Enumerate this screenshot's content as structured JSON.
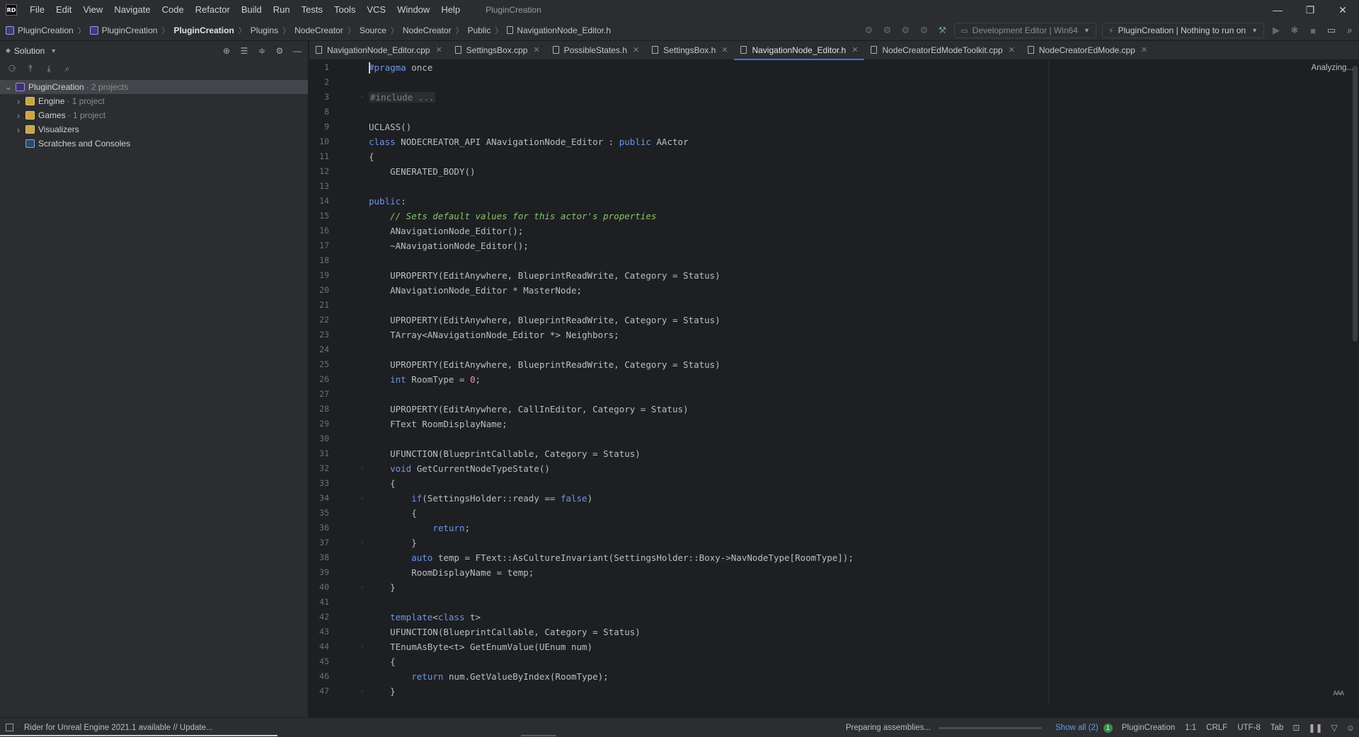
{
  "app": {
    "logo_text": "RD",
    "window_title": "PluginCreation"
  },
  "menu": [
    "File",
    "Edit",
    "View",
    "Navigate",
    "Code",
    "Refactor",
    "Build",
    "Run",
    "Tests",
    "Tools",
    "VCS",
    "Window",
    "Help"
  ],
  "window_controls": {
    "minimize": "—",
    "restore": "❐",
    "close": "✕"
  },
  "breadcrumb": [
    "PluginCreation",
    "PluginCreation",
    "PluginCreation",
    "Plugins",
    "NodeCreator",
    "Source",
    "NodeCreator",
    "Public",
    "NavigationNode_Editor.h"
  ],
  "toolbar": {
    "config_dropdown": "Development Editor | Win64",
    "run_dropdown": "PluginCreation | Nothing to run on",
    "icons": [
      "build-gear-icon",
      "build-solution-icon",
      "rebuild-icon",
      "clean-icon",
      "hammer-icon"
    ]
  },
  "solution": {
    "title": "Solution",
    "tree": [
      {
        "label": "PluginCreation",
        "meta": "· 2 projects",
        "icon": "solution-icon",
        "expanded": true,
        "selected": true
      },
      {
        "label": "Engine",
        "meta": "· 1 project",
        "icon": "folder-icon",
        "expanded": false
      },
      {
        "label": "Games",
        "meta": "· 1 project",
        "icon": "folder-icon",
        "expanded": false
      },
      {
        "label": "Visualizers",
        "meta": "",
        "icon": "folder-icon",
        "expanded": false
      },
      {
        "label": "Scratches and Consoles",
        "meta": "",
        "icon": "scratch-icon",
        "expanded": false
      }
    ]
  },
  "tabs": [
    {
      "label": "NavigationNode_Editor.cpp",
      "active": false
    },
    {
      "label": "SettingsBox.cpp",
      "active": false
    },
    {
      "label": "PossibleStates.h",
      "active": false
    },
    {
      "label": "SettingsBox.h",
      "active": false
    },
    {
      "label": "NavigationNode_Editor.h",
      "active": true
    },
    {
      "label": "NodeCreatorEdModeToolkit.cpp",
      "active": false
    },
    {
      "label": "NodeCreatorEdMode.cpp",
      "active": false
    }
  ],
  "editor": {
    "analyzing": "Analyzing...",
    "line_numbers": [
      "1",
      "2",
      "3",
      "8",
      "9",
      "10",
      "11",
      "12",
      "13",
      "14",
      "15",
      "16",
      "17",
      "18",
      "19",
      "20",
      "21",
      "22",
      "23",
      "24",
      "25",
      "26",
      "27",
      "28",
      "29",
      "30",
      "31",
      "32",
      "33",
      "34",
      "35",
      "36",
      "37",
      "38",
      "39",
      "40",
      "41",
      "42",
      "43",
      "44",
      "45",
      "46",
      "47"
    ],
    "lines": [
      "#pragma once",
      "",
      "#include ...",
      "",
      "UCLASS()",
      "class NODECREATOR_API ANavigationNode_Editor : public AActor",
      "{",
      "    GENERATED_BODY()",
      "",
      "public:",
      "    // Sets default values for this actor's properties",
      "    ANavigationNode_Editor();",
      "    ~ANavigationNode_Editor();",
      "",
      "    UPROPERTY(EditAnywhere, BlueprintReadWrite, Category = Status)",
      "    ANavigationNode_Editor * MasterNode;",
      "",
      "    UPROPERTY(EditAnywhere, BlueprintReadWrite, Category = Status)",
      "    TArray<ANavigationNode_Editor *> Neighbors;",
      "",
      "    UPROPERTY(EditAnywhere, BlueprintReadWrite, Category = Status)",
      "    int RoomType = 0;",
      "",
      "    UPROPERTY(EditAnywhere, CallInEditor, Category = Status)",
      "    FText RoomDisplayName;",
      "",
      "    UFUNCTION(BlueprintCallable, Category = Status)",
      "    void GetCurrentNodeTypeState()",
      "    {",
      "        if(SettingsHolder::ready == false)",
      "        {",
      "            return;",
      "        }",
      "        auto temp = FText::AsCultureInvariant(SettingsHolder::Boxy->NavNodeType[RoomType]);",
      "        RoomDisplayName = temp;",
      "    }",
      "",
      "    template<class t>",
      "    UFUNCTION(BlueprintCallable, Category = Status)",
      "    TEnumAsByte<t> GetEnumValue(UEnum num)",
      "    {",
      "        return num.GetValueByIndex(RoomType);",
      "    }"
    ]
  },
  "status": {
    "left": "Rider for Unreal Engine 2021.1 available // Update...",
    "preparing": "Preparing assemblies...",
    "show_all": "Show all (2)",
    "badge": "1",
    "project": "PluginCreation",
    "position": "1:1",
    "line_ending": "CRLF",
    "encoding": "UTF-8",
    "indent": "Tab"
  },
  "colors": {
    "accent": "#3574f0",
    "keyword": "#6c95eb",
    "comment": "#85c46c",
    "number": "#ed94c0",
    "background": "#1e1f22",
    "panel": "#2b2d30"
  }
}
